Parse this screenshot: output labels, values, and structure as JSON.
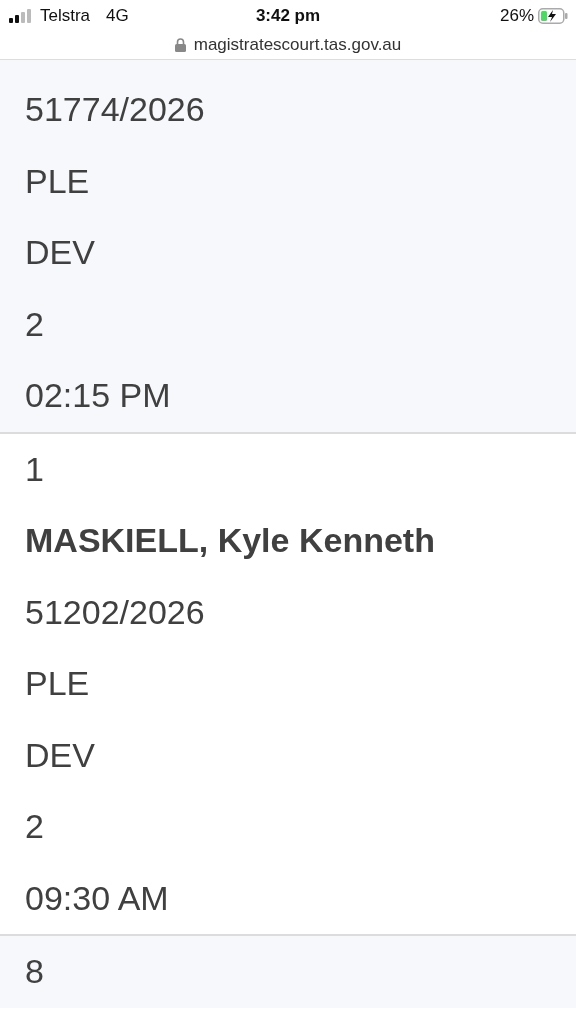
{
  "status_bar": {
    "carrier": "Telstra",
    "network": "4G",
    "time": "3:42 pm",
    "battery": "26%",
    "url": "magistratescourt.tas.gov.au"
  },
  "records": [
    {
      "fields": [
        {
          "kind": "text",
          "text": "51774/2026"
        },
        {
          "kind": "text",
          "text": "PLE"
        },
        {
          "kind": "text",
          "text": "DEV"
        },
        {
          "kind": "text",
          "text": "2"
        },
        {
          "kind": "text",
          "text": "02:15 PM"
        }
      ]
    },
    {
      "fields": [
        {
          "kind": "text",
          "text": "1"
        },
        {
          "kind": "name",
          "text": "MASKIELL, Kyle Kenneth"
        },
        {
          "kind": "text",
          "text": "51202/2026"
        },
        {
          "kind": "text",
          "text": "PLE"
        },
        {
          "kind": "text",
          "text": "DEV"
        },
        {
          "kind": "text",
          "text": "2"
        },
        {
          "kind": "text",
          "text": "09:30 AM"
        }
      ]
    },
    {
      "fields": [
        {
          "kind": "text",
          "text": "8"
        }
      ]
    }
  ]
}
